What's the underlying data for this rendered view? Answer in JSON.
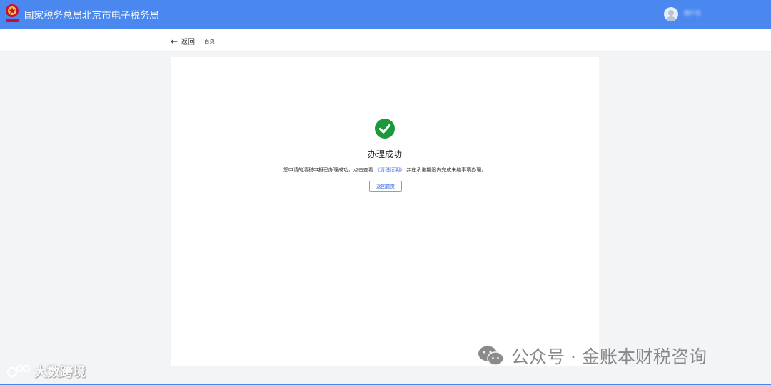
{
  "header": {
    "title": "国家税务总局北京市电子税务局",
    "user_name": "用户名"
  },
  "subnav": {
    "back_label": "返回",
    "crumb": "首页"
  },
  "result": {
    "title": "办理成功",
    "msg_before": "您申请的清税申报已办理成功，点击查看",
    "link_text": "《清税证明》",
    "msg_after": "并在承诺期限内完成未结事项办理。",
    "home_button": "返回首页"
  },
  "watermarks": {
    "left": "大数跨境",
    "right": "公众号 · 金账本财税咨询"
  },
  "colors": {
    "header_bg": "#4a88f0",
    "success": "#1a9a3a",
    "link": "#3a6ee0"
  }
}
